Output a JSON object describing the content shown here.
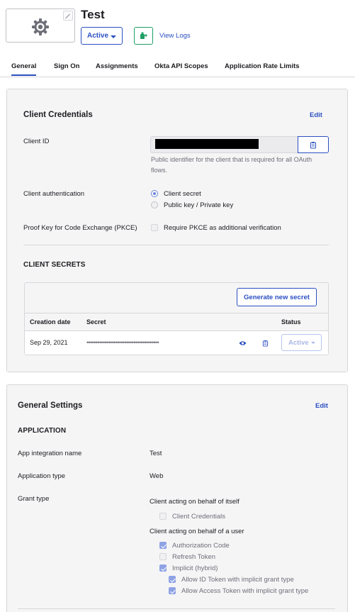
{
  "header": {
    "app_title": "Test",
    "status": "Active",
    "view_logs": "View Logs"
  },
  "tabs": [
    {
      "label": "General",
      "active": true
    },
    {
      "label": "Sign On",
      "active": false
    },
    {
      "label": "Assignments",
      "active": false
    },
    {
      "label": "Okta API Scopes",
      "active": false
    },
    {
      "label": "Application Rate Limits",
      "active": false
    }
  ],
  "client_credentials": {
    "title": "Client Credentials",
    "edit": "Edit",
    "client_id_label": "Client ID",
    "client_id_help": "Public identifier for the client that is required for all OAuth flows.",
    "auth_label": "Client authentication",
    "auth_options": [
      "Client secret",
      "Public key / Private key"
    ],
    "auth_selected": "Client secret",
    "pkce_label": "Proof Key for Code Exchange (PKCE)",
    "pkce_option": "Require PKCE as additional verification",
    "pkce_checked": false
  },
  "client_secrets": {
    "title": "CLIENT SECRETS",
    "generate_button": "Generate new secret",
    "columns": [
      "Creation date",
      "Secret",
      "Status"
    ],
    "rows": [
      {
        "creation_date": "Sep 29, 2021",
        "secret": "••••••••••••••••••••••••••••••••••••••••",
        "status": "Active"
      }
    ]
  },
  "general_settings": {
    "title": "General Settings",
    "edit": "Edit",
    "section": "APPLICATION",
    "app_name_label": "App integration name",
    "app_name_value": "Test",
    "app_type_label": "Application type",
    "app_type_value": "Web",
    "grant_type_label": "Grant type",
    "group_self": "Client acting on behalf of itself",
    "group_user": "Client acting on behalf of a user",
    "grants": [
      {
        "label": "Client Credentials",
        "checked": false,
        "disabled": true
      },
      {
        "label": "Authorization Code",
        "checked": true,
        "disabled": true
      },
      {
        "label": "Refresh Token",
        "checked": false,
        "disabled": true
      },
      {
        "label": "Implicit (hybrid)",
        "checked": true,
        "disabled": true
      },
      {
        "label": "Allow ID Token with implicit grant type",
        "checked": true,
        "disabled": true
      },
      {
        "label": "Allow Access Token with implicit grant type",
        "checked": true,
        "disabled": true
      }
    ]
  },
  "colors": {
    "accent": "#2b4fc1",
    "push_green": "#1e9e66",
    "card_bg": "#f5f5f6",
    "border": "#d7d7dc"
  },
  "icons": [
    "gear-icon",
    "pencil-icon",
    "chevron-down-icon",
    "push-icon",
    "copy-icon",
    "eye-icon"
  ]
}
